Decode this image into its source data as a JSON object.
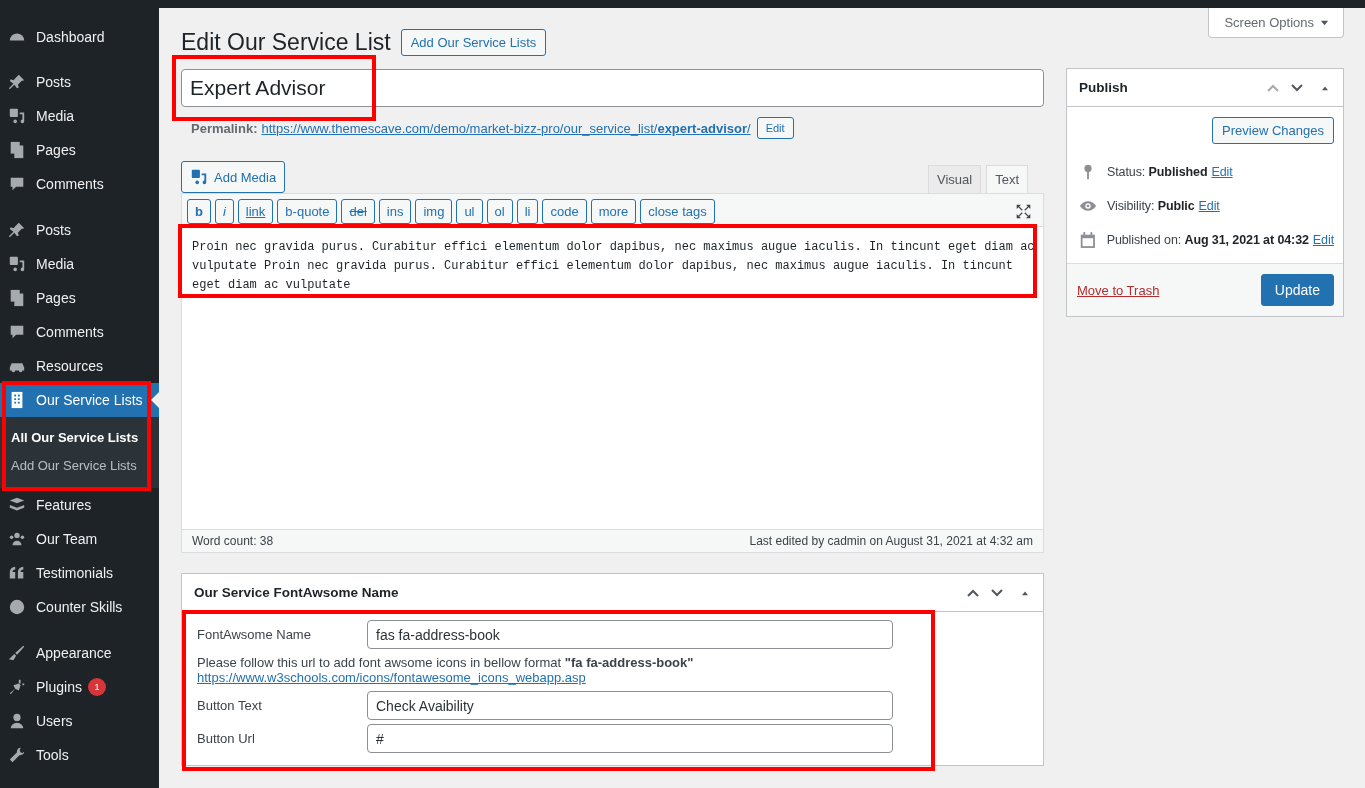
{
  "sidebar": {
    "groups": [
      [
        {
          "label": "Dashboard",
          "selected": false
        }
      ],
      [
        {
          "label": "Posts",
          "selected": false
        },
        {
          "label": "Media",
          "selected": false
        },
        {
          "label": "Pages",
          "selected": false
        },
        {
          "label": "Comments",
          "selected": false
        }
      ],
      [
        {
          "label": "Posts",
          "selected": false
        },
        {
          "label": "Media",
          "selected": false
        },
        {
          "label": "Pages",
          "selected": false
        },
        {
          "label": "Comments",
          "selected": false
        },
        {
          "label": "Resources",
          "selected": false
        },
        {
          "label": "Our Service Lists",
          "selected": true,
          "highlighted": true,
          "children": [
            {
              "label": "All Our Service Lists",
              "selected": true
            },
            {
              "label": "Add Our Service Lists",
              "selected": false
            }
          ]
        },
        {
          "label": "Features",
          "selected": false
        },
        {
          "label": "Our Team",
          "selected": false
        },
        {
          "label": "Testimonials",
          "selected": false
        },
        {
          "label": "Counter Skills",
          "selected": false
        }
      ],
      [
        {
          "label": "Appearance",
          "selected": false
        },
        {
          "label": "Plugins",
          "selected": false,
          "badge": "1"
        },
        {
          "label": "Users",
          "selected": false
        },
        {
          "label": "Tools",
          "selected": false
        }
      ]
    ]
  },
  "screen_options": "Screen Options",
  "heading": "Edit Our Service List",
  "add_new_button": "Add Our Service Lists",
  "title_field": {
    "value": "Expert Advisor",
    "highlighted": true
  },
  "permalink": {
    "label": "Permalink:",
    "url": "https://www.themescave.com/demo/market-bizz-pro/our_service_list/**expert-advisor**/",
    "button": "Edit"
  },
  "add_media": "Add Media",
  "editor_tabs": [
    {
      "label": "Visual",
      "selected": false
    },
    {
      "label": "Text",
      "selected": true
    }
  ],
  "quicktags": [
    "b",
    "i",
    "link",
    "b-quote",
    "del",
    "ins",
    "img",
    "ul",
    "ol",
    "li",
    "code",
    "more",
    "close tags"
  ],
  "editor": {
    "content": "Proin nec gravida purus. Curabitur effici elementum dolor dapibus, nec maximus augue iaculis. In tincunt eget diam ac vulputate Proin nec gravida purus. Curabitur effici elementum dolor dapibus, nec maximus augue iaculis. In tincunt eget diam ac vulputate",
    "highlighted": true
  },
  "status_bar": {
    "word_count": "Word count: 38",
    "last_edited": "Last edited by cadmin on August 31, 2021 at 4:32 am"
  },
  "metabox": {
    "title": "Our Service FontAwsome Name",
    "highlighted": true,
    "fields": [
      {
        "label": "FontAwsome Name",
        "value": "fas fa-address-book"
      },
      {
        "label": "Button Text",
        "value": "Check Avaibility"
      },
      {
        "label": "Button Url",
        "value": "#"
      }
    ],
    "help": "Please follow this url to add font awsome icons in bellow format **\"fa fa-address-book\"**",
    "help_link": "https://www.w3schools.com/icons/fontawesome_icons_webapp.asp"
  },
  "publish": {
    "title": "Publish",
    "preview_button": "Preview Changes",
    "rows": [
      {
        "label": "Status:",
        "value": "Published",
        "link": "Edit"
      },
      {
        "label": "Visibility:",
        "value": "Public",
        "link": "Edit"
      },
      {
        "label": "Published on:",
        "value": "Aug 31, 2021 at 04:32",
        "link": "Edit"
      }
    ],
    "trash": "Move to Trash",
    "update": "Update"
  }
}
